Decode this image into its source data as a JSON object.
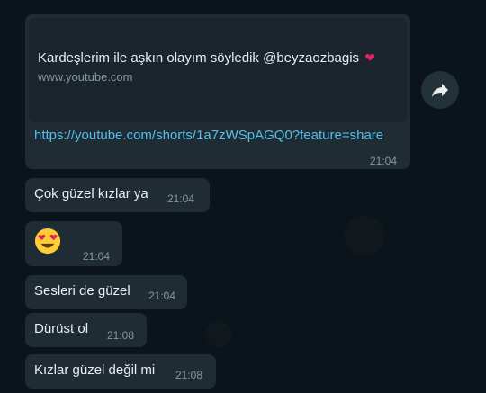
{
  "link_message": {
    "preview_title": "Kardeşlerim ile aşkın olayım söyledik @beyzaozbagis",
    "preview_domain": "www.youtube.com",
    "url": "https://youtube.com/shorts/1a7zWSpAGQ0?feature=share",
    "time": "21:04",
    "title_icon": "heart-emoji"
  },
  "share_button": {
    "icon": "forward-arrow-icon"
  },
  "messages": [
    {
      "text": "Çok güzel kızlar ya",
      "time": "21:04"
    },
    {
      "emoji": "heart-eyes-emoji",
      "time": "21:04"
    },
    {
      "text": "Sesleri de güzel",
      "time": "21:04"
    },
    {
      "text": "Dürüst ol",
      "time": "21:08"
    },
    {
      "text": "Kızlar güzel değil mi",
      "time": "21:08"
    }
  ],
  "colors": {
    "background": "#0b141a",
    "bubble": "#1f2c34",
    "link": "#53bdeb",
    "meta": "#8696a0",
    "text": "#e9edef"
  }
}
